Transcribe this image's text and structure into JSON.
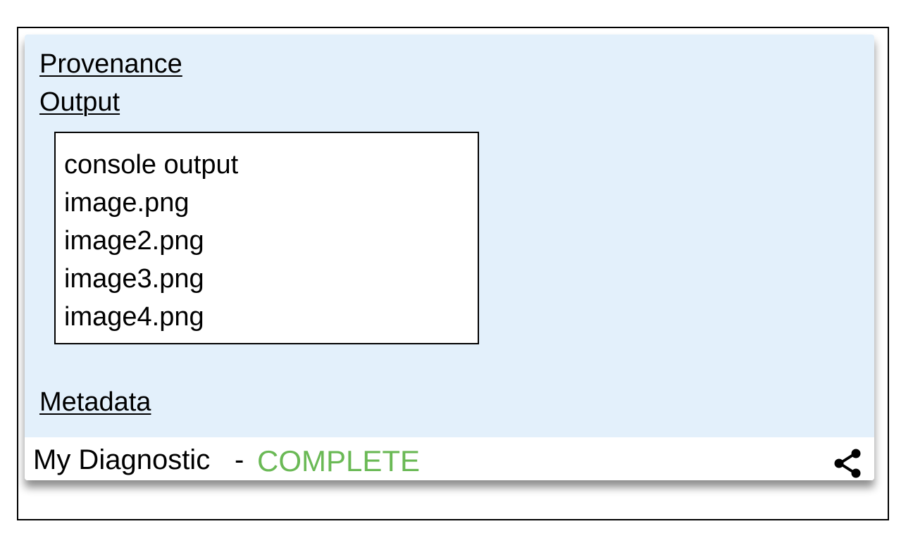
{
  "sections": {
    "provenance_label": "Provenance",
    "output_label": "Output",
    "metadata_label": "Metadata"
  },
  "outputs": [
    "console output",
    "image.png",
    "image2.png",
    "image3.png",
    "image4.png"
  ],
  "footer": {
    "title": "My Diagnostic",
    "separator": "-",
    "status": "COMPLETE",
    "status_color": "#6ab955",
    "share_icon": "share-icon"
  },
  "colors": {
    "card_background": "#e3f0fb",
    "border": "#000000"
  }
}
